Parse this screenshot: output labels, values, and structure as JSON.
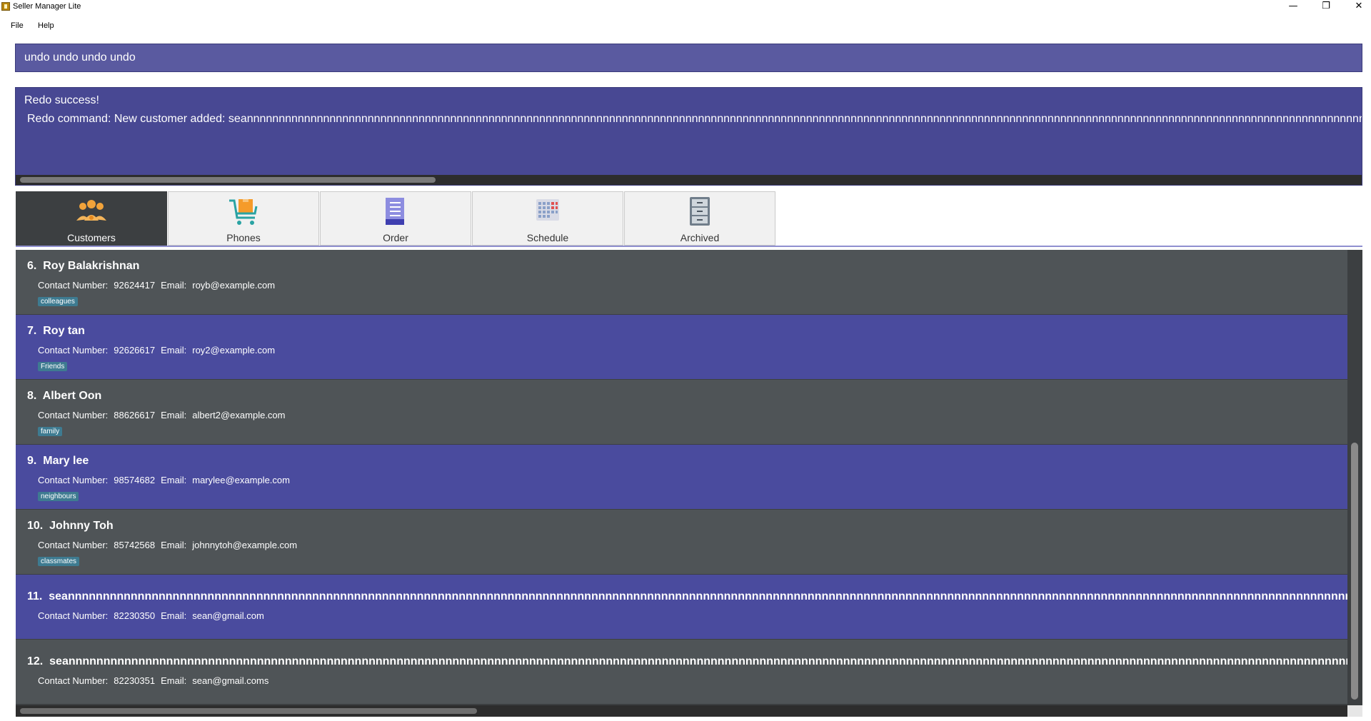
{
  "window": {
    "title": "Seller Manager Lite",
    "controls": [
      "—",
      "❐",
      "✕"
    ]
  },
  "menu": [
    "File",
    "Help"
  ],
  "command": {
    "value": "undo undo undo undo"
  },
  "result": {
    "line1": "Redo success!",
    "line2": "Redo command: New customer added: seannnnnnnnnnnnnnnnnnnnnnnnnnnnnnnnnnnnnnnnnnnnnnnnnnnnnnnnnnnnnnnnnnnnnnnnnnnnnnnnnnnnnnnnnnnnnnnnnnnnnnnnnnnnnnnnnnnnnnnnnnnnnnnnnnnnnnnnnnnnnnnnnnnnnnnnnnnnnnnnnnnnnnnnnnnnnnnnnnnnnnnnnnnnnnnnnnnnnnnnnnnnnnnnnnn"
  },
  "tabs": [
    {
      "label": "Customers",
      "icon": "customers-icon"
    },
    {
      "label": "Phones",
      "icon": "cart-icon"
    },
    {
      "label": "Order",
      "icon": "order-icon"
    },
    {
      "label": "Schedule",
      "icon": "calendar-icon"
    },
    {
      "label": "Archived",
      "icon": "cabinet-icon"
    }
  ],
  "labels": {
    "contact": "Contact Number:",
    "email": "Email:"
  },
  "customers": [
    {
      "index": "6.",
      "name": "Roy Balakrishnan",
      "phone": "92624417",
      "email": "royb@example.com",
      "tag": "colleagues"
    },
    {
      "index": "7.",
      "name": "Roy tan",
      "phone": "92626617",
      "email": "roy2@example.com",
      "tag": "Friends"
    },
    {
      "index": "8.",
      "name": "Albert Oon",
      "phone": "88626617",
      "email": "albert2@example.com",
      "tag": "family"
    },
    {
      "index": "9.",
      "name": "Mary lee",
      "phone": "98574682",
      "email": "marylee@example.com",
      "tag": "neighbours"
    },
    {
      "index": "10.",
      "name": "Johnny Toh",
      "phone": "85742568",
      "email": "johnnytoh@example.com",
      "tag": "classmates"
    },
    {
      "index": "11.",
      "name": "seannnnnnnnnnnnnnnnnnnnnnnnnnnnnnnnnnnnnnnnnnnnnnnnnnnnnnnnnnnnnnnnnnnnnnnnnnnnnnnnnnnnnnnnnnnnnnnnnnnnnnnnnnnnnnnnnnnnnnnnnnnnnnnnnnnnnnnnnnnnnnnnnnnnnnnnnnnnnnnnnnnnnnnnnnnnnnnnnnnnnnnnnnnnnnnnnnnnnnn",
      "phone": "82230350",
      "email": "sean@gmail.com",
      "tag": ""
    },
    {
      "index": "12.",
      "name": "seannnnnnnnnnnnnnnnnnnnnnnnnnnnnnnnnnnnnnnnnnnnnnnnnnnnnnnnnnnnnnnnnnnnnnnnnnnnnnnnnnnnnnnnnnnnnnnnnnnnnnnnnnnnnnnnnnnnnnnnnnnnnnnnnnnnnnnnnnnnnnnnnnnnnnnnnnnnnnnnnnnnnnnnnnnnnnnnnnnnnnnnnnnnnnnnnnnnnnnnnn",
      "phone": "82230351",
      "email": "sean@gmail.coms",
      "tag": ""
    }
  ],
  "colors": {
    "card_gray": "#4f5457",
    "card_blue": "#4a4b9e",
    "tag_bg": "#3e7b91",
    "command_bg": "#5a5aa0",
    "result_bg": "#484893",
    "active_tab": "#3c3f41"
  }
}
